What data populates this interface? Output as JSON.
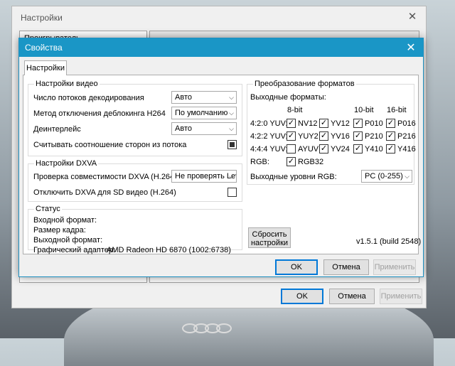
{
  "outer_window": {
    "title": "Настройки",
    "close_glyph": "✕",
    "tree_item": "Проигрыватель",
    "ok_label": "OK",
    "cancel_label": "Отмена",
    "apply_label": "Применить"
  },
  "dialog": {
    "title": "Свойства",
    "close_glyph": "✕",
    "tab_label": "Настройки",
    "video": {
      "title": "Настройки видео",
      "decode_streams_label": "Число потоков декодирования",
      "decode_streams_value": "Авто",
      "deblock_label": "Метод отключения деблокинга H264",
      "deblock_value": "По умолчанию",
      "deinterlace_label": "Деинтерлейс",
      "deinterlace_value": "Авто",
      "aspect_label": "Считывать соотношение сторон из потока"
    },
    "dxva": {
      "title": "Настройки DXVA",
      "compat_label": "Проверка совместимости DXVA (H.264)",
      "compat_value": "Не проверять Lev",
      "disable_sd_label": "Отключить DXVA для SD видео (H.264)"
    },
    "status": {
      "title": "Статус",
      "input_format": "Входной формат:",
      "frame_size": "Размер кадра:",
      "output_format": "Выходной формат:",
      "adapter_label": "Графический адаптер:",
      "adapter_value": "AMD Radeon HD 6870 (1002:6738)"
    },
    "formats": {
      "title": "Преобразование форматов",
      "output_formats_label": "Выходные форматы:",
      "col_8bit": "8-bit",
      "col_10bit": "10-bit",
      "col_16bit": "16-bit",
      "rows": [
        {
          "label": "4:2:0 YUV:",
          "items": [
            {
              "name": "NV12",
              "checked": true
            },
            {
              "name": "YV12",
              "checked": true
            },
            {
              "name": "P010",
              "checked": true
            },
            {
              "name": "P016",
              "checked": true
            }
          ]
        },
        {
          "label": "4:2:2 YUV:",
          "items": [
            {
              "name": "YUY2",
              "checked": true
            },
            {
              "name": "YV16",
              "checked": true
            },
            {
              "name": "P210",
              "checked": true
            },
            {
              "name": "P216",
              "checked": true
            }
          ]
        },
        {
          "label": "4:4:4 YUV:",
          "items": [
            {
              "name": "AYUV",
              "checked": false
            },
            {
              "name": "YV24",
              "checked": true
            },
            {
              "name": "Y410",
              "checked": true
            },
            {
              "name": "Y416",
              "checked": true
            }
          ]
        }
      ],
      "rgb_label": "RGB:",
      "rgb32": "RGB32",
      "rgb_levels_label": "Выходные уровни RGB:",
      "rgb_levels_value": "PC (0-255)"
    },
    "reset_label_line1": "Сбросить",
    "reset_label_line2": "настройки",
    "version": "v1.5.1 (build 2548)",
    "ok_label": "OK",
    "cancel_label": "Отмена",
    "apply_label": "Применить",
    "check_glyph": "✓",
    "combo_arrow": "⌵"
  }
}
